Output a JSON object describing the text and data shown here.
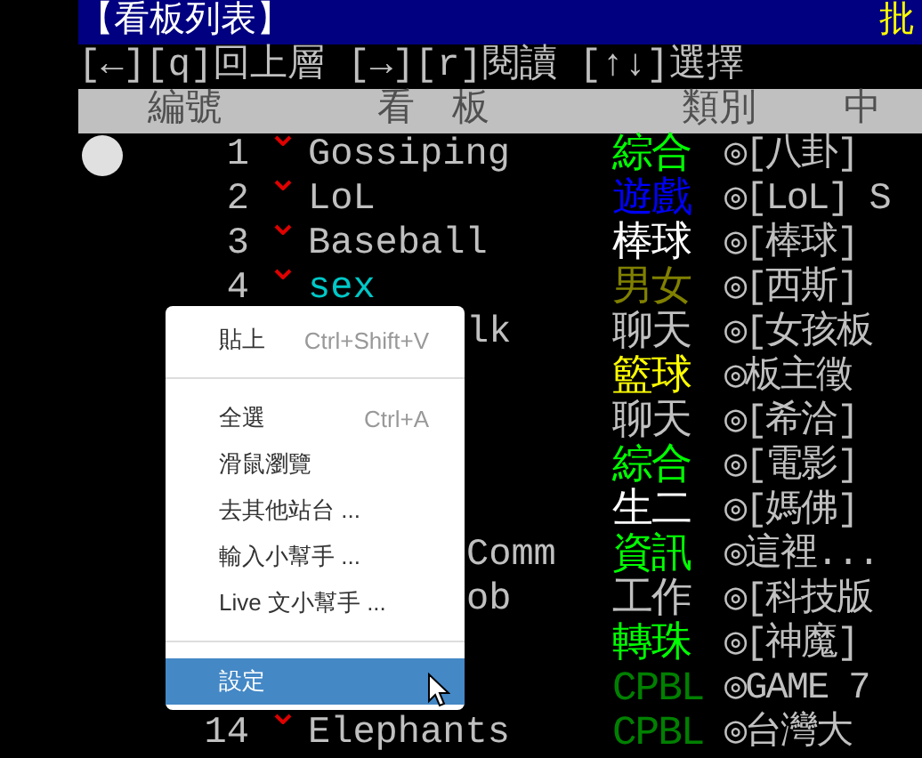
{
  "title_bar": {
    "title": "【看板列表】",
    "site": "批"
  },
  "help_line": "[←][q]回上層 [→][r]閱讀 [↑↓]選擇",
  "columns": [
    "編號",
    "看　板",
    "類別",
    "中"
  ],
  "boards": [
    {
      "kind": "visible",
      "cursor": true,
      "number": "1",
      "marked": true,
      "name": {
        "text": "Gossiping",
        "color": "#c0c0c0"
      },
      "category": {
        "text": "綜合",
        "color": "#00ff00"
      },
      "description": "◎[八卦]"
    },
    {
      "kind": "visible",
      "cursor": false,
      "number": "2",
      "marked": true,
      "name": {
        "text": "LoL",
        "color": "#c0c0c0"
      },
      "category": {
        "text": "遊戲",
        "color": "#0000ff"
      },
      "description": "◎[LoL] S"
    },
    {
      "kind": "visible",
      "cursor": false,
      "number": "3",
      "marked": true,
      "name": {
        "text": "Baseball",
        "color": "#c0c0c0"
      },
      "category": {
        "text": "棒球",
        "color": "#ffffff"
      },
      "description": "◎[棒球]"
    },
    {
      "kind": "visible",
      "cursor": false,
      "number": "4",
      "marked": true,
      "name": {
        "text": "sex",
        "color": "#00c8c8"
      },
      "category": {
        "text": "男女",
        "color": "#808000"
      },
      "description": "◎[西斯]"
    },
    {
      "kind": "covered",
      "name": {
        "text": "lk",
        "color": "#c0c0c0"
      },
      "category": {
        "text": "聊天",
        "color": "#c0c0c0"
      },
      "description": "◎[女孩板"
    },
    {
      "kind": "covered",
      "category": {
        "text": "籃球",
        "color": "#ffff00"
      },
      "description": "◎板主徵"
    },
    {
      "kind": "covered",
      "category": {
        "text": "聊天",
        "color": "#c0c0c0"
      },
      "description": "◎[希洽]"
    },
    {
      "kind": "covered",
      "category": {
        "text": "綜合",
        "color": "#00ff00"
      },
      "description": "◎[電影]"
    },
    {
      "kind": "covered",
      "category": {
        "text": "生二",
        "color": "#ffffff"
      },
      "description": "◎[媽佛]"
    },
    {
      "kind": "covered",
      "name": {
        "text": "Comm",
        "color": "#c0c0c0"
      },
      "category": {
        "text": "資訊",
        "color": "#00ff00"
      },
      "description": "◎這裡..."
    },
    {
      "kind": "covered",
      "name": {
        "text": "ob",
        "color": "#c0c0c0"
      },
      "category": {
        "text": "工作",
        "color": "#c0c0c0"
      },
      "description": "◎[科技版"
    },
    {
      "kind": "covered",
      "category": {
        "text": "轉珠",
        "color": "#00ff00"
      },
      "description": "◎[神魔]"
    },
    {
      "kind": "covered",
      "category": {
        "text": "CPBL",
        "color": "#008000"
      },
      "description": "◎GAME 7"
    },
    {
      "kind": "visible",
      "cursor": false,
      "number": "14",
      "marked": true,
      "name": {
        "text": "Elephants",
        "color": "#c0c0c0"
      },
      "category": {
        "text": "CPBL",
        "color": "#008000"
      },
      "description": "◎台灣大"
    }
  ],
  "context_menu": [
    {
      "kind": "item",
      "label": "貼上",
      "shortcut": "Ctrl+Shift+V",
      "selected": false
    },
    {
      "kind": "separator"
    },
    {
      "kind": "item",
      "label": "全選",
      "shortcut": "Ctrl+A",
      "selected": false
    },
    {
      "kind": "item",
      "label": "滑鼠瀏覽",
      "selected": false
    },
    {
      "kind": "item",
      "label": "去其他站台 ...",
      "selected": false
    },
    {
      "kind": "item",
      "label": "輸入小幫手 ...",
      "selected": false
    },
    {
      "kind": "item",
      "label": "Live 文小幫手 ...",
      "selected": false
    },
    {
      "kind": "separator"
    },
    {
      "kind": "item",
      "label": "設定",
      "selected": true
    }
  ]
}
